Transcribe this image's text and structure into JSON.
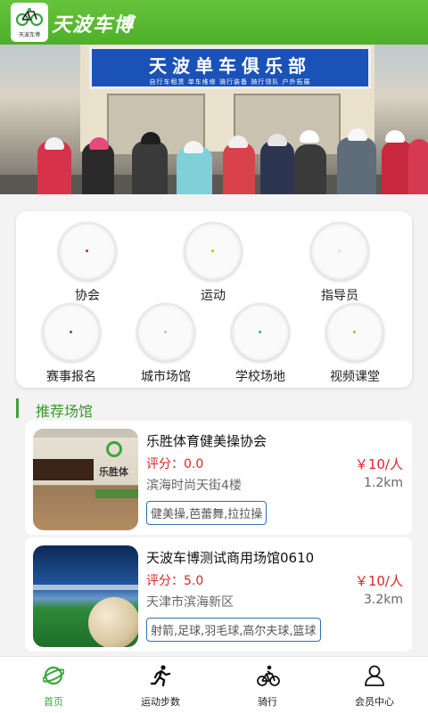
{
  "header": {
    "title": "天波车博",
    "logo_text": "天波车博",
    "accent": "#4eaf2a"
  },
  "banner": {
    "sign_title": "天波单车俱乐部",
    "sign_sub": "自行车租赁  单车维修  骑行装备  骑行领队  户外拓展"
  },
  "categories": [
    {
      "label": "协会",
      "icon": "association-icon",
      "dot": "#c02b2b"
    },
    {
      "label": "运动",
      "icon": "sport-icon",
      "dot": "#d6b10a"
    },
    {
      "label": "指导员",
      "icon": "instructor-icon",
      "dot": "#dddddd"
    },
    {
      "label": "赛事报名",
      "icon": "event-signup-icon",
      "dot": "#2d56c8"
    },
    {
      "label": "城市场馆",
      "icon": "city-venue-icon",
      "dot": "#bbbbbb"
    },
    {
      "label": "学校场地",
      "icon": "school-field-icon",
      "dot": "#2bb3a3"
    },
    {
      "label": "视频课堂",
      "icon": "video-class-icon",
      "dot": "#a8b95a"
    }
  ],
  "section": {
    "title": "推荐场馆"
  },
  "venues": [
    {
      "name": "乐胜体育健美操协会",
      "rating": "评分：0.0",
      "price": "￥10/人",
      "address": "滨海时尚天街4楼",
      "distance": "1.2km",
      "tags": "健美操,芭蕾舞,拉拉操",
      "wall_text": "乐胜体"
    },
    {
      "name": "天波车博测试商用场馆0610",
      "rating": "评分：5.0",
      "price": "￥10/人",
      "address": "天津市滨海新区",
      "distance": "3.2km",
      "tags": "射箭,足球,羽毛球,高尔夫球,篮球"
    }
  ],
  "tabbar": [
    {
      "label": "首页",
      "icon": "home-planet-icon",
      "active": true
    },
    {
      "label": "运动步数",
      "icon": "running-icon",
      "active": false
    },
    {
      "label": "骑行",
      "icon": "cycling-icon",
      "active": false
    },
    {
      "label": "会员中心",
      "icon": "user-icon",
      "active": false
    }
  ]
}
